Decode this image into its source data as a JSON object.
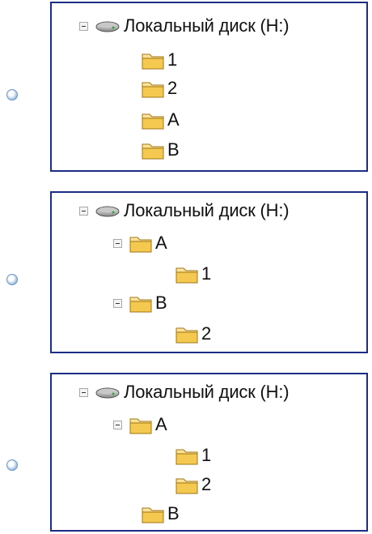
{
  "options": [
    {
      "drive_label": "Локальный диск (H:)",
      "folders": [
        {
          "label": "1"
        },
        {
          "label": "2"
        },
        {
          "label": "A"
        },
        {
          "label": "B"
        }
      ]
    },
    {
      "drive_label": "Локальный диск (H:)",
      "folders": [
        {
          "label": "A",
          "children": [
            {
              "label": "1"
            }
          ]
        },
        {
          "label": "B",
          "children": [
            {
              "label": "2"
            }
          ]
        }
      ]
    },
    {
      "drive_label": "Локальный диск (H:)",
      "folders": [
        {
          "label": "A",
          "children": [
            {
              "label": "1"
            },
            {
              "label": "2"
            }
          ]
        },
        {
          "label": "B"
        }
      ]
    }
  ]
}
